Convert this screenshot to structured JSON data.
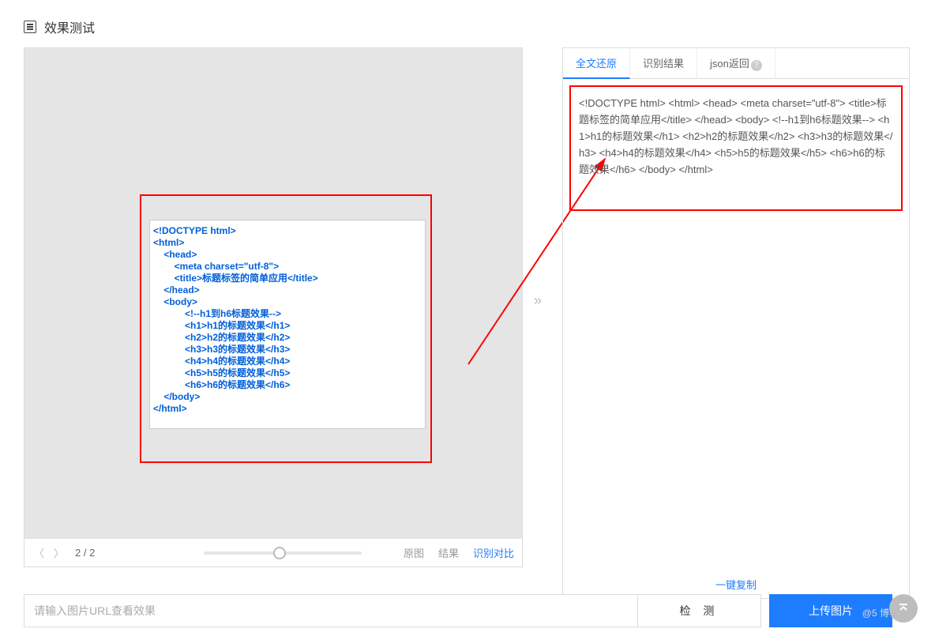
{
  "header": {
    "title": "效果测试"
  },
  "preview": {
    "code_text": "<!DOCTYPE html>\n<html>\n    <head>\n        <meta charset=\"utf-8\">\n        <title>标题标签的简单应用</title>\n    </head>\n    <body>\n            <!--h1到h6标题效果-->\n            <h1>h1的标题效果</h1>\n            <h2>h2的标题效果</h2>\n            <h3>h3的标题效果</h3>\n            <h4>h4的标题效果</h4>\n            <h5>h5的标题效果</h5>\n            <h6>h6的标题效果</h6>\n    </body>\n</html>",
    "footer": {
      "page": "2 / 2",
      "links": {
        "original": "原图",
        "result": "结果",
        "compare": "识别对比"
      }
    }
  },
  "tabs": {
    "full": "全文还原",
    "recognize": "识别结果",
    "json": "json返回"
  },
  "result": {
    "text": "<!DOCTYPE html> <html> <head> <meta charset=\"utf-8\"> <title>标题标签的简单应用</title> </head> <body> <!--h1到h6标题效果--> <h1>h1的标题效果</h1> <h2>h2的标题效果</h2> <h3>h3的标题效果</h3> <h4>h4的标题效果</h4> <h5>h5的标题效果</h5> <h6>h6的标题效果</h6> </body> </html>",
    "copy": "一键复制"
  },
  "bottom": {
    "placeholder": "请输入图片URL查看效果",
    "detect": "检 测",
    "upload": "上传图片"
  },
  "watermark": "@5  博客"
}
